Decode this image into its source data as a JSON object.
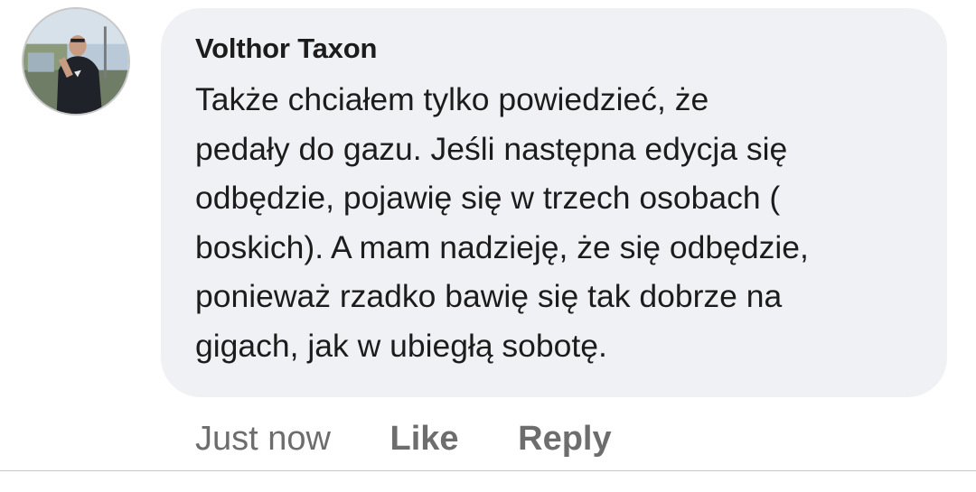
{
  "comment": {
    "author": "Volthor Taxon",
    "lines": [
      "Także chciałem tylko powiedzieć, że",
      "pedały do gazu. Jeśli następna edycja się",
      "odbędzie, pojawię się w trzech osobach (",
      "boskich). A mam nadzieję, że się odbędzie,",
      "ponieważ rzadko bawię się tak dobrze na",
      "gigach, jak w ubiegłą sobotę."
    ],
    "timestamp": "Just now",
    "like_label": "Like",
    "reply_label": "Reply"
  },
  "colors": {
    "bubble_background": "#f0f1f5",
    "text": "#1c1c1c",
    "meta_text": "#6d6d6d"
  },
  "icons": {
    "avatar": "profile-photo"
  }
}
